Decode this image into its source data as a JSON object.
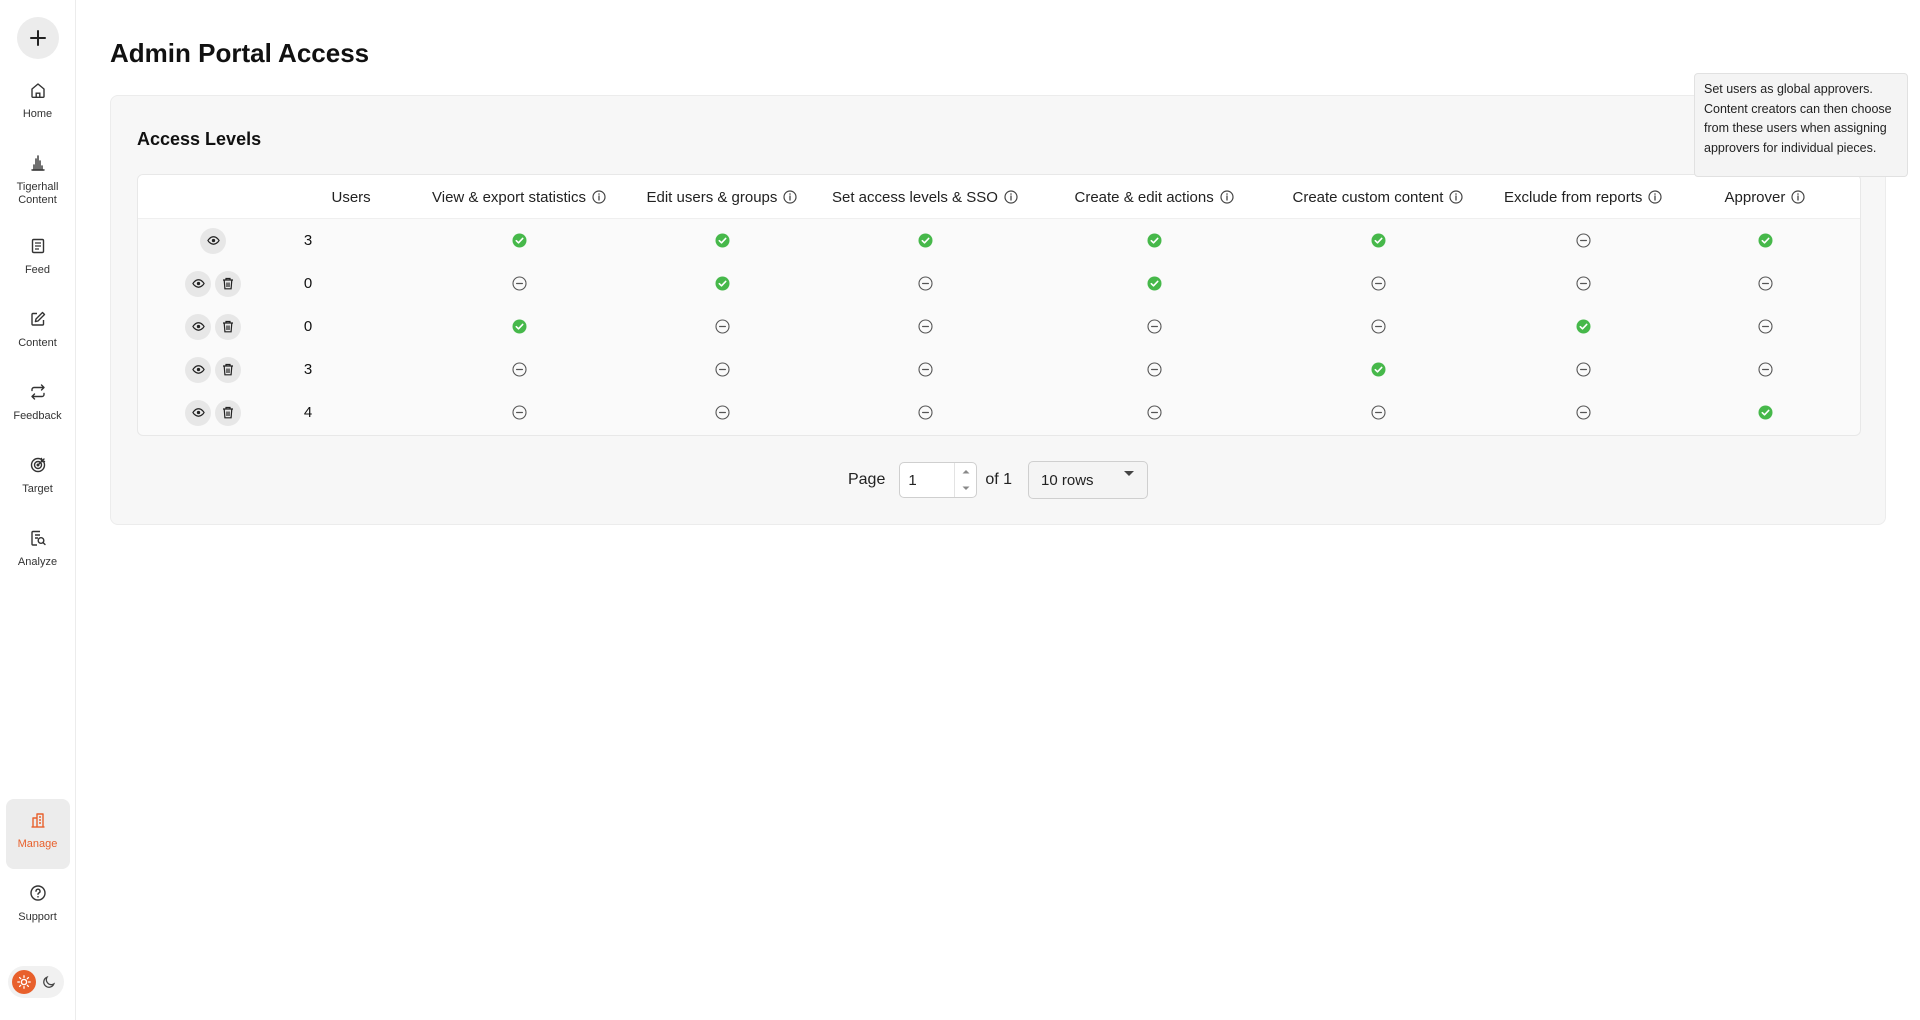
{
  "sidebar": {
    "add_icon": "plus-icon",
    "items": [
      {
        "label": "Home",
        "icon": "home-icon"
      },
      {
        "label": "Tigerhall Content",
        "icon": "tigerhall-icon"
      },
      {
        "label": "Feed",
        "icon": "feed-icon"
      },
      {
        "label": "Content",
        "icon": "edit-icon"
      },
      {
        "label": "Feedback",
        "icon": "feedback-icon"
      },
      {
        "label": "Target",
        "icon": "target-icon"
      },
      {
        "label": "Analyze",
        "icon": "analyze-icon"
      }
    ],
    "bottom_items": [
      {
        "label": "Manage",
        "icon": "manage-icon",
        "active": true
      },
      {
        "label": "Support",
        "icon": "help-icon"
      }
    ],
    "accent_color": "#e8602c"
  },
  "page": {
    "title": "Admin Portal Access"
  },
  "access_levels": {
    "title": "Access Levels",
    "columns": [
      "Users",
      "View & export statistics",
      "Edit users & groups",
      "Set access levels & SSO",
      "Create & edit actions",
      "Create custom content",
      "Exclude from reports",
      "Approver"
    ],
    "rows": [
      {
        "deletable": false,
        "users": "3",
        "perms": [
          true,
          true,
          true,
          true,
          true,
          false,
          true
        ]
      },
      {
        "deletable": true,
        "users": "0",
        "perms": [
          false,
          true,
          false,
          true,
          false,
          false,
          false
        ]
      },
      {
        "deletable": true,
        "users": "0",
        "perms": [
          true,
          false,
          false,
          false,
          false,
          true,
          false
        ]
      },
      {
        "deletable": true,
        "users": "3",
        "perms": [
          false,
          false,
          false,
          false,
          true,
          false,
          false
        ]
      },
      {
        "deletable": true,
        "users": "4",
        "perms": [
          false,
          false,
          false,
          false,
          false,
          false,
          true
        ]
      }
    ],
    "check_color": "#46b84a"
  },
  "pagination": {
    "page_label": "Page",
    "current_page": "1",
    "of_label": "of 1",
    "rows_option": "10 rows"
  },
  "tooltip": {
    "text": "Set users as global approvers. Content creators can then choose from these users when assigning approvers for individual pieces."
  }
}
